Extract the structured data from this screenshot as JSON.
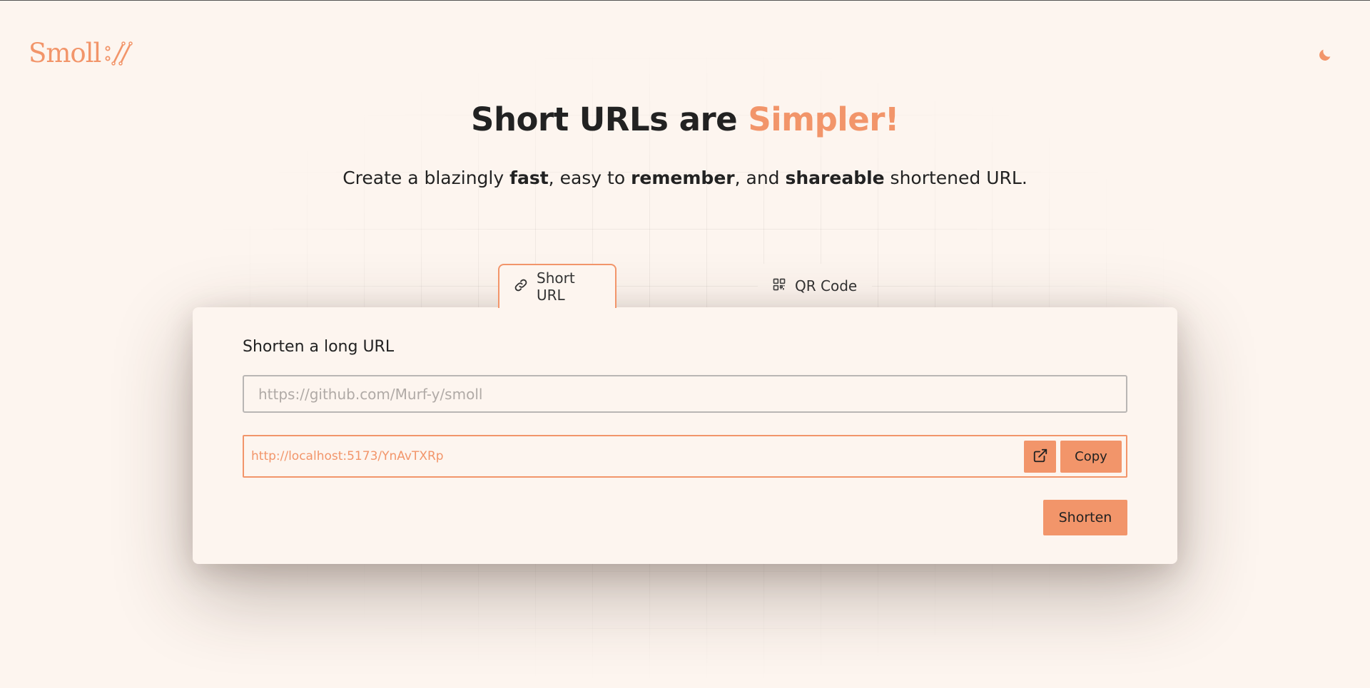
{
  "brand": {
    "logo_text": "Smoll",
    "accent_color": "#f2956a",
    "mark_icon": "slashes-mark-icon"
  },
  "header": {
    "theme_toggle_icon": "moon-icon"
  },
  "hero": {
    "title_main": "Short URLs are",
    "title_accent": "Simpler!",
    "subtitle": {
      "part1": "Create a blazingly ",
      "fast": "fast",
      "part2": ", easy to ",
      "remember": "remember",
      "part3": ", and ",
      "shareable": "shareable",
      "part4": " shortened URL."
    }
  },
  "tabs": [
    {
      "label": "Short URL",
      "icon": "link-icon",
      "active": true
    },
    {
      "label": "QR Code",
      "icon": "qr-code-icon",
      "active": false
    }
  ],
  "form": {
    "heading": "Shorten a long URL",
    "input_value": "",
    "input_placeholder": "https://github.com/Murf-y/smoll",
    "result_url": "http://localhost:5173/YnAvTXRp",
    "open_icon": "external-link-icon",
    "copy_label": "Copy",
    "submit_label": "Shorten"
  }
}
